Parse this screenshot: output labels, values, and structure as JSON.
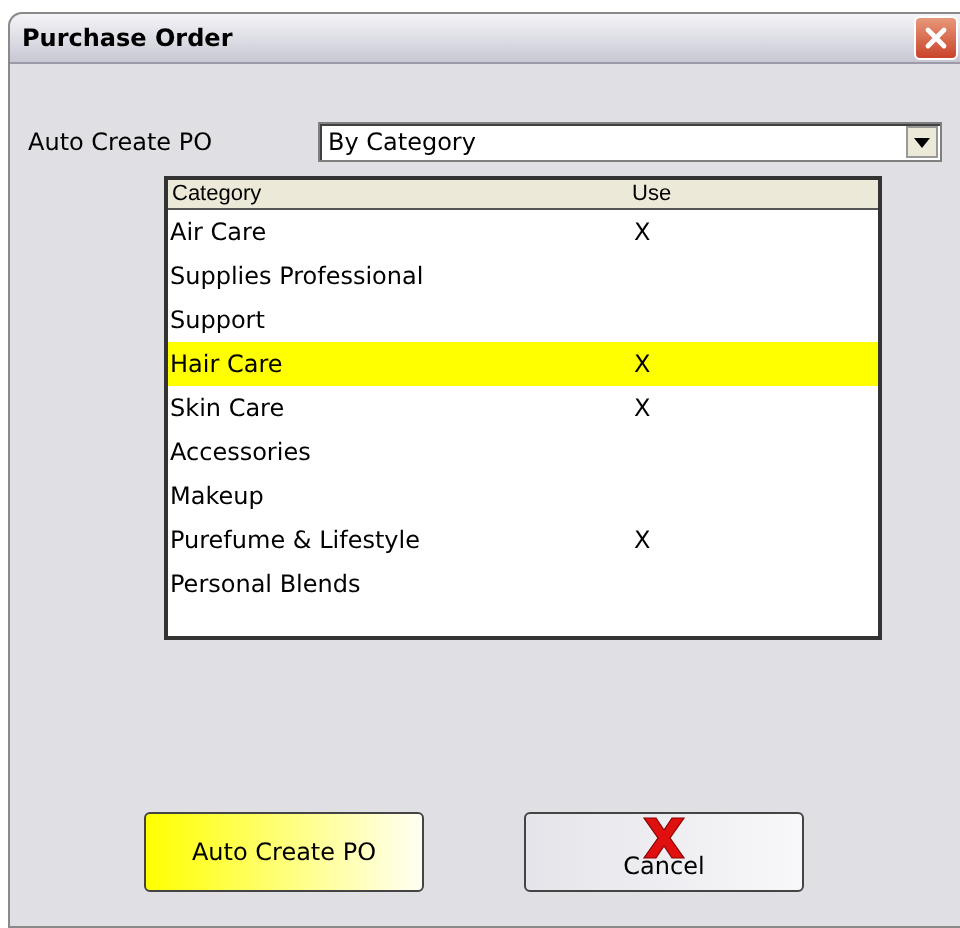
{
  "window": {
    "title": "Purchase Order"
  },
  "auto_create": {
    "label": "Auto Create PO",
    "value": "By Category"
  },
  "table": {
    "columns": [
      "Category",
      "Use"
    ],
    "rows": [
      {
        "category": "Air Care",
        "use": "X",
        "selected": false
      },
      {
        "category": "Supplies Professional",
        "selected": false
      },
      {
        "category": "Support",
        "selected": false
      },
      {
        "category": "Hair Care",
        "use": "X",
        "selected": true
      },
      {
        "category": "Skin Care",
        "use": "X",
        "selected": false
      },
      {
        "category": "Accessories",
        "selected": false
      },
      {
        "category": "Makeup",
        "selected": false
      },
      {
        "category": "Purefume & Lifestyle",
        "use": "X",
        "selected": false
      },
      {
        "category": "Personal Blends",
        "selected": false
      }
    ]
  },
  "buttons": [
    {
      "kind": "primary",
      "label": "Auto Create PO"
    },
    {
      "kind": "cancel",
      "label": "Cancel"
    }
  ]
}
